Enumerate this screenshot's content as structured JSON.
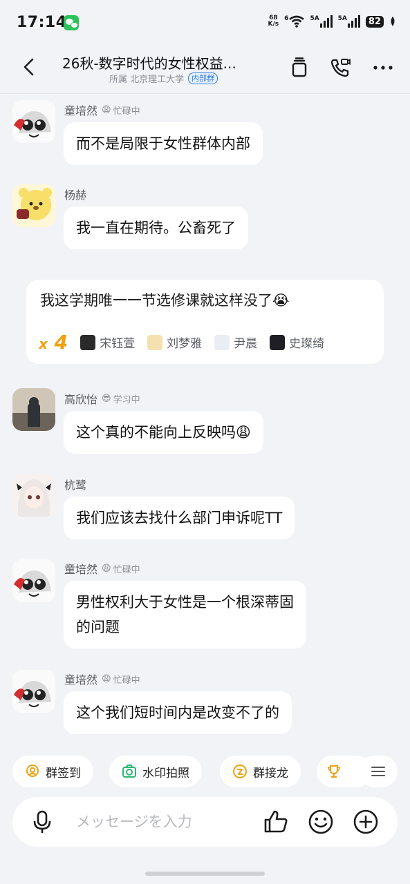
{
  "status_bar": {
    "time": "17:14",
    "net_speed_value": "68",
    "net_speed_unit": "K/s",
    "wifi_tag": "6",
    "sim1_tag": "5A",
    "sim2_tag": "5A",
    "battery": "82"
  },
  "header": {
    "title": "26秋-数字时代的女性权益...",
    "affiliation": "所属 北京理工大学",
    "group_tag": "内部群"
  },
  "messages": [
    {
      "sender": "童培然",
      "status_emoji": "😩",
      "status": "忙碌中",
      "text": "而不是局限于女性群体内部"
    },
    {
      "sender": "杨赫",
      "text": "我一直在期待。公畜死了"
    },
    {
      "sender": "高欣怡",
      "status_emoji": "😎",
      "status": "学习中",
      "text": "这个真的不能向上反映吗😩"
    },
    {
      "sender": "杭鹭",
      "text": "我们应该去找什么部门申诉呢TT"
    },
    {
      "sender": "童培然",
      "status_emoji": "😩",
      "status": "忙碌中",
      "text_line1": "男性权利大于女性是一个根深蒂固",
      "text_line2": "的问题"
    },
    {
      "sender": "童培然",
      "status_emoji": "😩",
      "status": "忙碌中",
      "text": "这个我们短时间内是改变不了的"
    }
  ],
  "highlight": {
    "text": "我这学期唯一一节选修课就这样没了😭",
    "count_prefix": "x",
    "count": "4",
    "reactors": [
      "宋钰萱",
      "刘梦雅",
      "尹晨",
      "史璨绮"
    ]
  },
  "toolbar": {
    "items": [
      "群签到",
      "水印拍照",
      "群接龙"
    ]
  },
  "input": {
    "placeholder": "メッセージを入力"
  },
  "colors": {
    "background": "#f2f3f7",
    "bubble": "#ffffff",
    "accent_orange": "#f0a010",
    "tag_blue": "#2b7bea"
  }
}
